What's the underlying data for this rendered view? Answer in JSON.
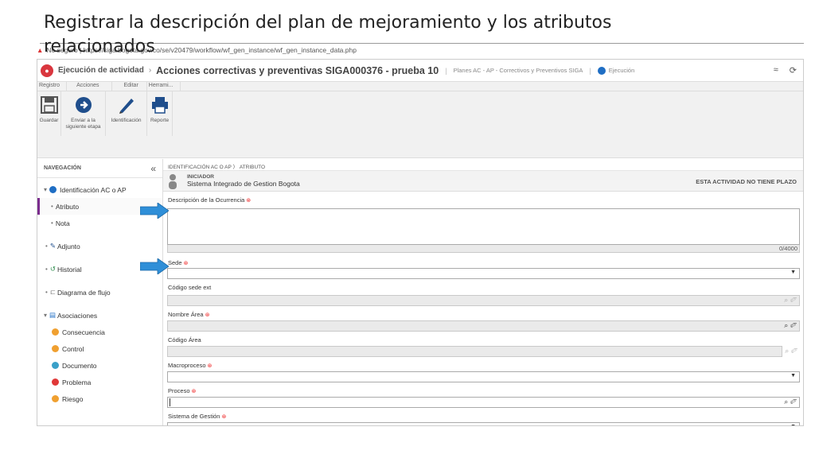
{
  "slide": {
    "title": "Registrar la descripción del plan de mejoramiento y los atributos relacionados"
  },
  "browser": {
    "warning": "▲",
    "url": "No seguro | https://siga.bogota.gov.co/se/v20479/workflow/wf_gen_instance/wf_gen_instance_data.php"
  },
  "header": {
    "app_name": "Ejecución de actividad",
    "doc_title": "Acciones correctivas y preventivas SIGA000376 - prueba 10",
    "crumb": "Planes AC - AP - Correctivos y Preventivos SIGA",
    "status": "Ejecución",
    "collapse_glyph": "≈",
    "refresh_glyph": "⟳"
  },
  "ribbon": {
    "tabs": [
      "Registro",
      "Acciones",
      "Editar",
      "Herrami..."
    ],
    "buttons": {
      "save": "Guardar",
      "send_line1": "Enviar a la",
      "send_line2": "siguiente etapa",
      "identify": "Identificación",
      "report": "Reporte"
    }
  },
  "nav": {
    "header": "NAVEGACIÓN",
    "collapse": "«",
    "items": [
      {
        "label": "Identificación AC o AP"
      },
      {
        "label": "Atributo"
      },
      {
        "label": "Nota"
      },
      {
        "label": "Adjunto"
      },
      {
        "label": "Historial"
      },
      {
        "label": "Diagrama de flujo"
      },
      {
        "label": "Asociaciones"
      },
      {
        "label": "Consecuencia"
      },
      {
        "label": "Control"
      },
      {
        "label": "Documento"
      },
      {
        "label": "Problema"
      },
      {
        "label": "Riesgo"
      }
    ]
  },
  "main": {
    "breadcrumb": "IDENTIFICACIÓN AC O AP 〉 ATRIBUTO",
    "initiator_label": "INICIADOR",
    "initiator_name": "Sistema Integrado de Gestion Bogota",
    "no_deadline": "ESTA ACTIVIDAD NO TIENE PLAZO",
    "description_label": "Descripción de la Ocurrencia",
    "description_value": "",
    "char_count": "0/4000",
    "fields": {
      "sede": "Sede",
      "codigo_sede": "Código sede ext",
      "nombre_area": "Nombre Área",
      "codigo_area": "Código Área",
      "macroproceso": "Macroproceso",
      "proceso": "Proceso",
      "sistema": "Sistema de Gestión"
    },
    "required_mark": "⊛"
  },
  "colors": {
    "arrow": "#2f8fd8",
    "accent": "#7b2d8e",
    "logo": "#d9363e"
  }
}
